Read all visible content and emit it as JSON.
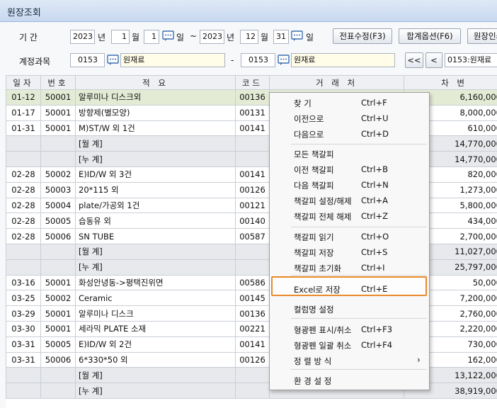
{
  "window": {
    "title": "원장조회"
  },
  "filters": {
    "period_label": "기    간",
    "year1": "2023",
    "year_label": "년",
    "month1": "1",
    "month_label": "월",
    "day1": "1",
    "day_label": "일",
    "tilde": "~",
    "year2": "2023",
    "month2": "12",
    "day2": "31",
    "account_label": "계정과목",
    "acc_code1": "0153",
    "acc_name1": "원재료",
    "dash": "-",
    "acc_code2": "0153",
    "acc_name2": "원재료",
    "acc_display": "0153:원재료"
  },
  "toolbar": {
    "voucher_edit": "전표수정(F3)",
    "total_option": "합계옵션(F6)",
    "ledger_print": "원장인쇄",
    "first": "<<",
    "prev": "<"
  },
  "grid": {
    "columns": [
      "일자",
      "번호",
      "적 요",
      "코드",
      "거 래 처",
      "차   변"
    ],
    "rows": [
      {
        "date": "01-12",
        "no": "50001",
        "desc": "알루미나 디스크외",
        "code": "00136",
        "partner": "",
        "debit": "6,160,000",
        "kind": "selected"
      },
      {
        "date": "01-17",
        "no": "50001",
        "desc": "방향제(별모양)",
        "code": "00131",
        "partner": "",
        "debit": "8,000,000",
        "kind": "normal"
      },
      {
        "date": "01-31",
        "no": "50001",
        "desc": "M)ST/W 외 1건",
        "code": "00141",
        "partner": "",
        "debit": "610,000",
        "kind": "normal"
      },
      {
        "date": "",
        "no": "",
        "desc": "[월        계]",
        "code": "",
        "partner": "",
        "debit": "14,770,000",
        "kind": "sub"
      },
      {
        "date": "",
        "no": "",
        "desc": "[누        계]",
        "code": "",
        "partner": "",
        "debit": "14,770,000",
        "kind": "sub"
      },
      {
        "date": "02-28",
        "no": "50002",
        "desc": "E)ID/W 외 3건",
        "code": "00141",
        "partner": "",
        "debit": "820,000",
        "kind": "normal"
      },
      {
        "date": "02-28",
        "no": "50003",
        "desc": "20*115 외",
        "code": "00126",
        "partner": "",
        "debit": "1,273,000",
        "kind": "normal"
      },
      {
        "date": "02-28",
        "no": "50004",
        "desc": "plate/가공외 1건",
        "code": "00121",
        "partner": "",
        "debit": "5,800,000",
        "kind": "normal"
      },
      {
        "date": "02-28",
        "no": "50005",
        "desc": "습동유 외",
        "code": "00140",
        "partner": "",
        "debit": "434,000",
        "kind": "normal"
      },
      {
        "date": "02-28",
        "no": "50006",
        "desc": "SN TUBE",
        "code": "00587",
        "partner": "",
        "debit": "2,700,000",
        "kind": "normal"
      },
      {
        "date": "",
        "no": "",
        "desc": "[월        계]",
        "code": "",
        "partner": "",
        "debit": "11,027,000",
        "kind": "sub"
      },
      {
        "date": "",
        "no": "",
        "desc": "[누        계]",
        "code": "",
        "partner": "",
        "debit": "25,797,000",
        "kind": "sub"
      },
      {
        "date": "03-16",
        "no": "50001",
        "desc": "화성안녕동->평택진위면",
        "code": "00586",
        "partner": "",
        "debit": "50,000",
        "kind": "normal"
      },
      {
        "date": "03-25",
        "no": "50002",
        "desc": "Ceramic",
        "code": "00145",
        "partner": "",
        "debit": "7,200,000",
        "kind": "normal"
      },
      {
        "date": "03-29",
        "no": "50001",
        "desc": "알루미나 디스크",
        "code": "00136",
        "partner": "",
        "debit": "2,760,000",
        "kind": "normal"
      },
      {
        "date": "03-30",
        "no": "50001",
        "desc": "세라믹 PLATE 소재",
        "code": "00221",
        "partner": "",
        "debit": "2,220,000",
        "kind": "normal"
      },
      {
        "date": "03-31",
        "no": "50005",
        "desc": "E)ID/W 외 2건",
        "code": "00141",
        "partner": "",
        "debit": "730,000",
        "kind": "normal"
      },
      {
        "date": "03-31",
        "no": "50006",
        "desc": "6*330*50 외",
        "code": "00126",
        "partner": "",
        "debit": "162,000",
        "kind": "normal"
      },
      {
        "date": "",
        "no": "",
        "desc": "[월        계]",
        "code": "",
        "partner": "",
        "debit": "13,122,000",
        "kind": "sub"
      },
      {
        "date": "",
        "no": "",
        "desc": "[누        계]",
        "code": "",
        "partner": "",
        "debit": "38,919,000",
        "kind": "sub"
      }
    ]
  },
  "context_menu": {
    "items": [
      {
        "label": "찾    기",
        "shortcut": "Ctrl+F"
      },
      {
        "label": "이전으로",
        "shortcut": "Ctrl+U"
      },
      {
        "label": "다음으로",
        "shortcut": "Ctrl+D"
      },
      {
        "label": "모든 책갈피",
        "shortcut": ""
      },
      {
        "label": "이전 책갈피",
        "shortcut": "Ctrl+B"
      },
      {
        "label": "다음 책갈피",
        "shortcut": "Ctrl+N"
      },
      {
        "label": "책갈피 설정/해제",
        "shortcut": "Ctrl+A"
      },
      {
        "label": "책갈피 전체 해제",
        "shortcut": "Ctrl+Z"
      },
      {
        "label": "책갈피 읽기",
        "shortcut": "Ctrl+O"
      },
      {
        "label": "책갈피 저장",
        "shortcut": "Ctrl+S"
      },
      {
        "label": "책갈피 초기화",
        "shortcut": "Ctrl+I"
      },
      {
        "label": "Excel로 저장",
        "shortcut": "Ctrl+E"
      },
      {
        "label": "컬럼명 설정",
        "shortcut": ""
      },
      {
        "label": "형광펜 표시/취소",
        "shortcut": "Ctrl+F3"
      },
      {
        "label": "형광펜 일괄 취소",
        "shortcut": "Ctrl+F4"
      },
      {
        "label": "정 렬 방 식",
        "shortcut": "",
        "submenu": true
      },
      {
        "label": "환 경 설 정",
        "shortcut": ""
      }
    ]
  },
  "colors": {
    "highlight_border": "#e88a2a",
    "selected_row": "#e4ebd5",
    "subtotal_row": "#e7e9ec"
  }
}
